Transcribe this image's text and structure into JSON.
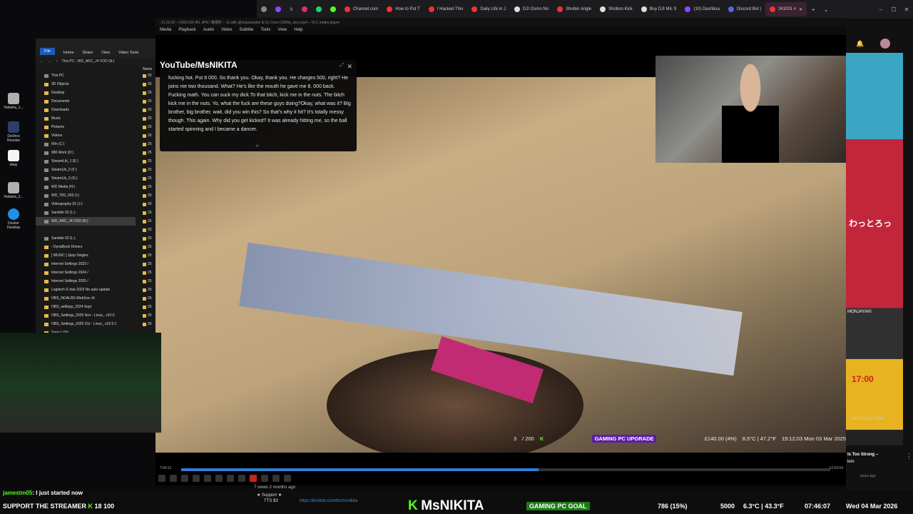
{
  "desktop": {
    "icons": [
      {
        "label": "Hahaha_1...",
        "color": "#b0b0b0"
      },
      {
        "label": "DaVinci Resolve",
        "color": "#2c3e6a"
      },
      {
        "label": "ebay",
        "color": "#f5f5f5"
      },
      {
        "label": "Hahaha_2...",
        "color": "#b0b0b0"
      },
      {
        "label": "Docker Desktop",
        "color": "#1d91e6"
      }
    ]
  },
  "browser": {
    "tabs": [
      {
        "label": "Channel.com",
        "color": "#e33"
      },
      {
        "label": "How to Put T",
        "color": "#e33"
      },
      {
        "label": "I Hacked This",
        "color": "#e33"
      },
      {
        "label": "Daily Life in J",
        "color": "#e33"
      },
      {
        "label": "DJI Osmo No",
        "color": "#ddd"
      },
      {
        "label": "Shutter Angle",
        "color": "#e33"
      },
      {
        "label": "Shobon Kick",
        "color": "#ddd"
      },
      {
        "label": "Buy DJI Mic S",
        "color": "#ddd"
      },
      {
        "label": "(10) Dashboa",
        "color": "#9146ff"
      },
      {
        "label": "Discord Bot |",
        "color": "#5865f2"
      },
      {
        "label": "241031 #",
        "color": "#e33"
      }
    ],
    "new_tab": "+",
    "dropdown": "⌄",
    "minimize": "–",
    "maximize": "☐",
    "close": "✕"
  },
  "vlc": {
    "title": "21.03.02 – #303-010 IRL JPN / 箱根町 – 11 with @iceposeidon & Cx Crew (1080p_sec).mp4 – VLC media player",
    "menu": [
      "Media",
      "Playback",
      "Audio",
      "Video",
      "Subtitle",
      "Tools",
      "View",
      "Help"
    ],
    "time_elapsed": "7:04:11",
    "time_total": "12:53:04",
    "progress": 0.55
  },
  "subtitles": {
    "brand": "YouTube/MsNIKITA",
    "text": "fucking hot. Put 8 000. So thank you. Okay, thank you. He charges 500, right? He joins me two thousand. What? He's like the mouth he gave me 8. 000 back. Fucking math. You can suck my dick.To that bitch, kick me in the nuts. The bitch kick me in the nuts. Yo, what the fuck are these guys doing?Okay, what was it? Big brother, big brother, wait, did you win this? So that's why it hit? It's totally messy though. This again. Why did you get kicked? It was already hitting me, so the ball started spinning and I became a dancer.",
    "close": "✕",
    "expand": "⤢",
    "collapse": "^"
  },
  "explorer": {
    "ribbon": [
      "File",
      "Home",
      "Share",
      "View",
      "Video Tools"
    ],
    "address": "This PC › WD_ARC_J4 VOD (N:)",
    "name_col": "Name",
    "tree": [
      {
        "label": "This PC",
        "type": "drive"
      },
      {
        "label": "3D Objects",
        "type": "folder"
      },
      {
        "label": "Desktop",
        "type": "folder"
      },
      {
        "label": "Documents",
        "type": "folder"
      },
      {
        "label": "Downloads",
        "type": "folder"
      },
      {
        "label": "Music",
        "type": "folder"
      },
      {
        "label": "Pictures",
        "type": "folder"
      },
      {
        "label": "Videos",
        "type": "folder"
      },
      {
        "label": "Win (C:)",
        "type": "drive"
      },
      {
        "label": "980 Work (D:)",
        "type": "drive"
      },
      {
        "label": "StreamLib_1 (E:)",
        "type": "drive"
      },
      {
        "label": "SteamLib_2 (F:)",
        "type": "drive"
      },
      {
        "label": "SteamLib_3 (G:)",
        "type": "drive"
      },
      {
        "label": "WD Media (H:)",
        "type": "drive"
      },
      {
        "label": "WD_TB3_003 (I:)",
        "type": "drive"
      },
      {
        "label": "Videography 02 (J:)",
        "type": "drive"
      },
      {
        "label": "Sandisk 02 (L:)",
        "type": "drive"
      },
      {
        "label": "WD_ARC_J4 VOD (N:)",
        "type": "drive",
        "selected": true
      },
      {
        "label": "",
        "type": "spacer"
      },
      {
        "label": "Sandisk 02 (L:)",
        "type": "drive"
      },
      {
        "label": "- DynaBook Drivers",
        "type": "folder"
      },
      {
        "label": "[ MUSIC ] Jpop Singles",
        "type": "folder"
      },
      {
        "label": "Internet Settings 2023 /",
        "type": "folder"
      },
      {
        "label": "Internet Settings 2024 /",
        "type": "folder"
      },
      {
        "label": "Internet Settings 2025 /",
        "type": "folder"
      },
      {
        "label": "Logitech G hub 2023 No auto-update",
        "type": "folder"
      },
      {
        "label": "OBS_NOALBS-WebSoc v5",
        "type": "folder"
      },
      {
        "label": "OBS_settings_2024 Sept",
        "type": "folder"
      },
      {
        "label": "OBS_Settings_2025 Nov - Linux_ v32.0.",
        "type": "folder"
      },
      {
        "label": "OBS_Settings_2025 Oct - Linux_ v32.0.1",
        "type": "folder"
      },
      {
        "label": "Sony LUTs",
        "type": "folder"
      }
    ],
    "file_prefix": "25"
  },
  "stream": {
    "counter": "3",
    "counter_total": "/ 200",
    "goal_label": "GAMING PC UPGRADE",
    "goal_amount": "£140.00 (4%)",
    "weather": "8.5°C | 47.2°F",
    "clock": "19:12:03 Mon 03 Mar 2025"
  },
  "right_panel": {
    "video_title": "Is Too Strong –",
    "video_sub": "lem",
    "ago": "years ago",
    "date": "Thur 31 Oct 2024",
    "ad_text1": "わっとろっ",
    "ad_text2": "17:00",
    "ad_text3": "MONJAYAKI",
    "menu": "⋮"
  },
  "bottom": {
    "chat_user": "jamestm05",
    "chat_msg": ": I just started now",
    "support": "SUPPORT THE STREAMER",
    "viewer_count": "18",
    "hundred": "100",
    "views": "7 views  2 months ago",
    "support_star": "★ Support ★",
    "tts": "TTS $3",
    "kick_link": "https://kickbot.com/tts/msnikita",
    "kick_k": "K",
    "kick_name": "MsNIKITA",
    "goal2": "GAMING PC GOAL",
    "goal2_amount": "786 (15%)",
    "count5000": "5000",
    "temp2": "6.3°C | 43.3°F",
    "time2": "07:46:07",
    "date2": "Wed 04 Mar 2026"
  },
  "colors": {
    "kick_green": "#53fc18",
    "goal_purple": "#5b1ea8",
    "vlc_blue": "#2f7fd6"
  }
}
